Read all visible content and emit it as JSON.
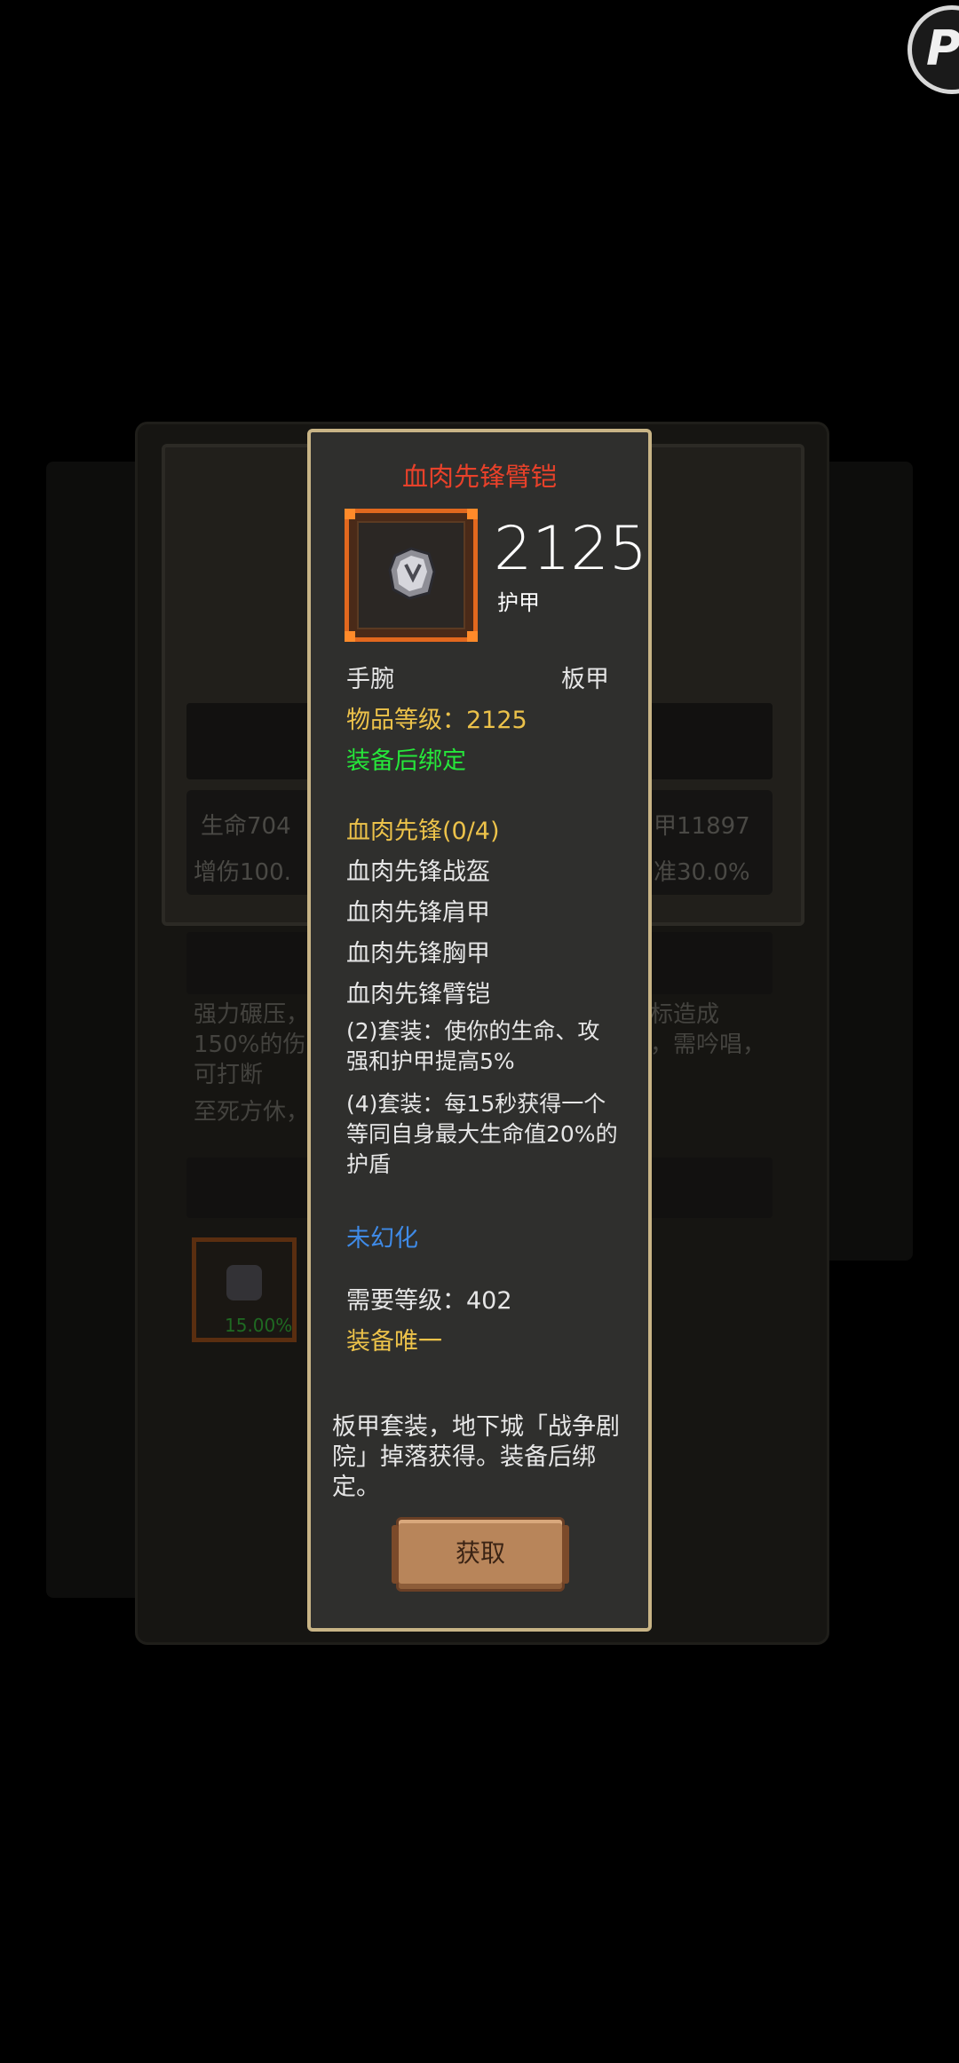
{
  "background": {
    "stat_row1_left": "生命704",
    "stat_row1_right": "甲11897",
    "stat_row2_left": "增伤100.",
    "stat_row2_right": "准30.0%",
    "desc_line1_left": "强力碾压，",
    "desc_line1_right": "标造成",
    "desc_line2_left": "150%的伤",
    "desc_line2_right": "，需吟唱，",
    "desc_line3": "可打断",
    "desc_line4": "至死方休，",
    "item_drop_rate": "15.00%"
  },
  "badge": {
    "letter": "P"
  },
  "tooltip": {
    "title": "血肉先锋臂铠",
    "icon": "gauntlet-icon",
    "armor_value": "2125",
    "armor_label": "护甲",
    "slot": "手腕",
    "armor_type": "板甲",
    "item_level": "物品等级：2125",
    "bind": "装备后绑定",
    "set_name": "血肉先锋(0/4)",
    "set_pieces": [
      "血肉先锋战盔",
      "血肉先锋肩甲",
      "血肉先锋胸甲",
      "血肉先锋臂铠"
    ],
    "set_bonus_2": "(2)套装：使你的生命、攻强和护甲提高5%",
    "set_bonus_4": "(4)套装：每15秒获得一个等同自身最大生命值20%的护盾",
    "transmog": "未幻化",
    "required_level": "需要等级：402",
    "unique": "装备唯一",
    "description": "板甲套装，地下城「战争剧院」掉落获得。装备后绑定。",
    "get_button": "获取"
  },
  "colors": {
    "title": "#e8412a",
    "gold": "#ecc24a",
    "green": "#26e63a",
    "blue": "#3f8be8",
    "border": "#c8b486",
    "frame": "#e2681e"
  }
}
